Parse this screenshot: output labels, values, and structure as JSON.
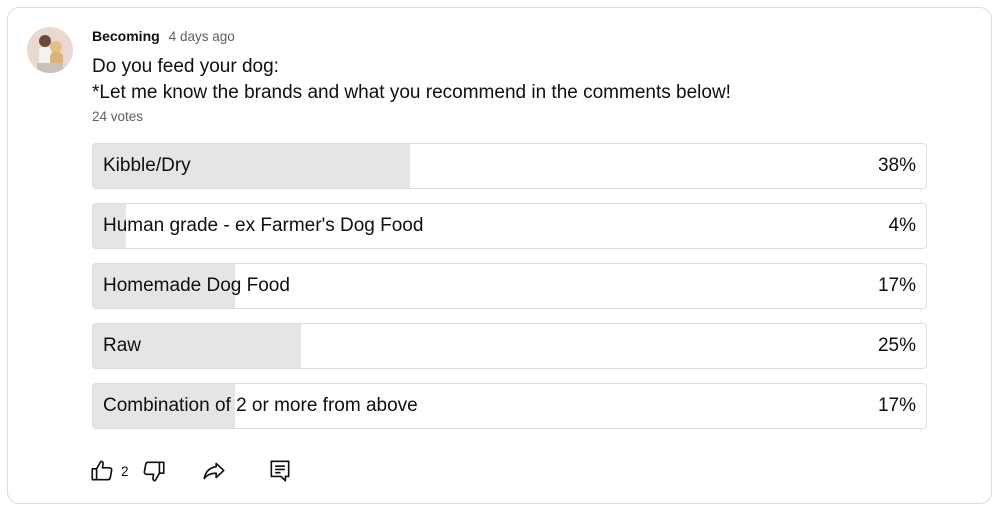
{
  "post": {
    "author": "Becoming",
    "time": "4 days ago",
    "question_line1": "Do you feed your dog:",
    "question_line2": "*Let me know the brands and what you recommend in the comments below!",
    "votes": "24 votes"
  },
  "poll": {
    "options": [
      {
        "label": "Kibble/Dry",
        "percent_text": "38%",
        "percent": 38
      },
      {
        "label": "Human grade - ex Farmer's Dog Food",
        "percent_text": "4%",
        "percent": 4
      },
      {
        "label": "Homemade Dog Food",
        "percent_text": "17%",
        "percent": 17
      },
      {
        "label": "Raw",
        "percent_text": "25%",
        "percent": 25
      },
      {
        "label": "Combination of 2 or more from above",
        "percent_text": "17%",
        "percent": 17
      }
    ]
  },
  "actions": {
    "like_count": "2",
    "icons": [
      "thumb-up-icon",
      "thumb-down-icon",
      "share-icon",
      "comment-icon"
    ]
  },
  "colors": {
    "fill": "#e5e5e5",
    "border": "#dcdcdc",
    "secondary_text": "#606060"
  }
}
